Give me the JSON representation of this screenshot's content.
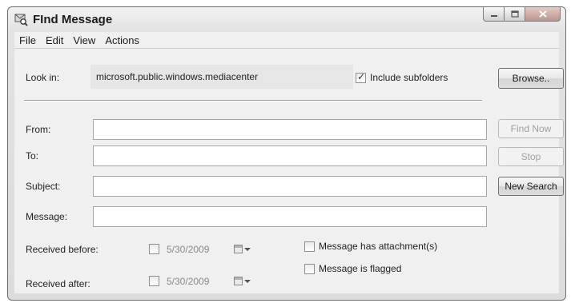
{
  "window": {
    "title": "FInd Message"
  },
  "menu": [
    "File",
    "Edit",
    "View",
    "Actions"
  ],
  "look_in": {
    "label": "Look in:",
    "value": "microsoft.public.windows.mediacenter",
    "include_subfolders_label": "Include subfolders",
    "include_subfolders_checked": true
  },
  "buttons": {
    "browse": "Browse..",
    "find_now": "Find Now",
    "stop": "Stop",
    "new_search": "New Search"
  },
  "fields": {
    "from_label": "From:",
    "from_value": "",
    "to_label": "To:",
    "to_value": "",
    "subject_label": "Subject:",
    "subject_value": "",
    "message_label": "Message:",
    "message_value": ""
  },
  "received_before": {
    "label": "Received before:",
    "date": "5/30/2009",
    "checked": false
  },
  "received_after": {
    "label": "Received after:",
    "date": "5/30/2009",
    "checked": false
  },
  "options": {
    "attachment_label": "Message has attachment(s)",
    "attachment_checked": false,
    "flagged_label": "Message is flagged",
    "flagged_checked": false
  },
  "icons": {
    "app": "find-message-icon",
    "minimize": "minimize-icon",
    "maximize": "maximize-icon",
    "close": "close-icon",
    "calendar": "calendar-icon"
  }
}
